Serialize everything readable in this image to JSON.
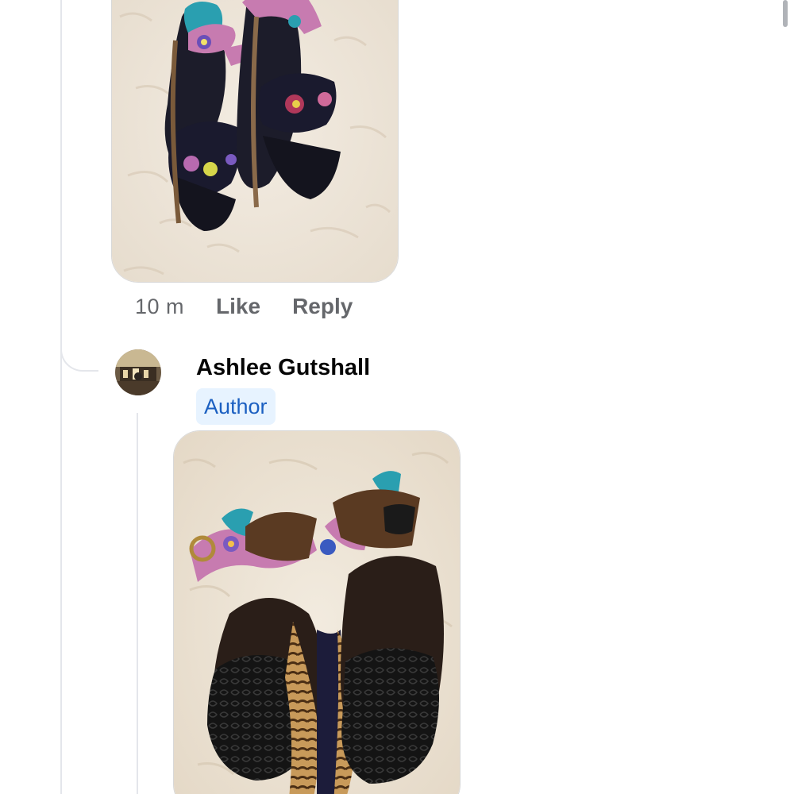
{
  "thread": {
    "previous_comment": {
      "image": {
        "icon": "photo-black-floral-sandals-top-view"
      },
      "actions": {
        "timestamp": "10 m",
        "like_label": "Like",
        "reply_label": "Reply"
      }
    },
    "reply_comment": {
      "author": {
        "name": "Ashlee Gutshall",
        "badge": "Author",
        "avatar_icon": "avatar-photo"
      },
      "image": {
        "icon": "photo-sandals-soles-view"
      }
    }
  },
  "colors": {
    "muted_text": "#65676b",
    "name_text": "#050505",
    "badge_bg": "#e7f3ff",
    "badge_text": "#1b5fc1",
    "thread_line": "#e4e6eb"
  }
}
